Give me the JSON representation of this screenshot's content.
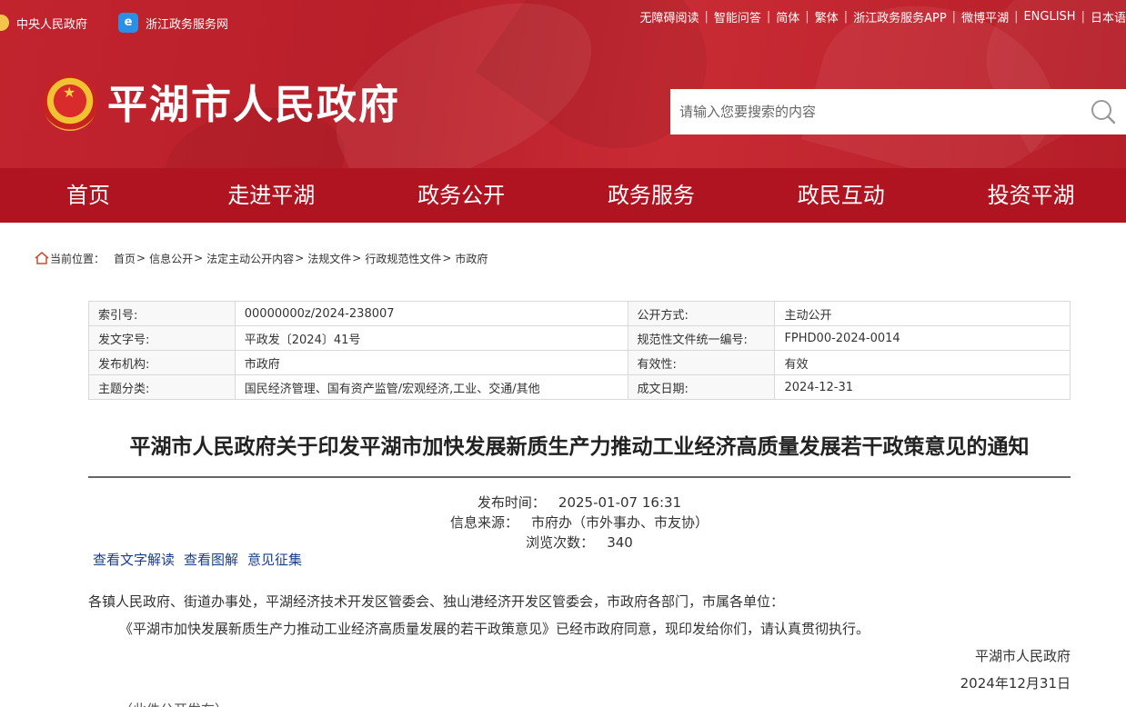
{
  "header": {
    "top_left_links": [
      {
        "label": "中央人民政府",
        "icon": "emblem-icon"
      },
      {
        "label": "浙江政务服务网",
        "icon": "zjzwfw-logo-icon"
      }
    ],
    "top_right_links": [
      "无障碍阅读",
      "智能问答",
      "简体",
      "繁体",
      "浙江政务服务APP",
      "微博平湖",
      "ENGLISH",
      "日本语"
    ],
    "site_title": "平湖市人民政府",
    "search_placeholder": "请输入您要搜索的内容"
  },
  "nav": {
    "items": [
      "首页",
      "走进平湖",
      "政务公开",
      "政务服务",
      "政民互动",
      "投资平湖"
    ]
  },
  "breadcrumb": {
    "label": "当前位置：",
    "items": [
      "首页",
      "信息公开",
      "法定主动公开内容",
      "法规文件",
      "行政规范性文件",
      "市政府"
    ]
  },
  "meta": {
    "rows": [
      {
        "l1": "索引号:",
        "v1": "00000000z/2024-238007",
        "l2": "公开方式:",
        "v2": "主动公开"
      },
      {
        "l1": "发文字号:",
        "v1": "平政发〔2024〕41号",
        "l2": "规范性文件统一编号:",
        "v2": "FPHD00-2024-0014"
      },
      {
        "l1": "发布机构:",
        "v1": "市政府",
        "l2": "有效性:",
        "v2": "有效"
      },
      {
        "l1": "主题分类:",
        "v1": "国民经济管理、国有资产监管/宏观经济,工业、交通/其他",
        "l2": "成文日期:",
        "v2": "2024-12-31"
      }
    ]
  },
  "article": {
    "title": "平湖市人民政府关于印发平湖市加快发展新质生产力推动工业经济高质量发展若干政策意见的通知",
    "publish_label": "发布时间：",
    "publish_value": "2025-01-07 16:31",
    "source_label": "信息来源：",
    "source_value": "市府办（市外事办、市友协）",
    "views_label": "浏览次数：",
    "views_value": "340",
    "links": [
      "查看文字解读",
      "查看图解",
      "意见征集"
    ],
    "para1": "各镇人民政府、街道办事处，平湖经济技术开发区管委会、独山港经济开发区管委会，市政府各部门，市属各单位：",
    "para2": "《平湖市加快发展新质生产力推动工业经济高质量发展的若干政策意见》已经市政府同意，现印发给你们，请认真贯彻执行。",
    "signature_org": "平湖市人民政府",
    "signature_date": "2024年12月31日",
    "para3": "（此件公开发布）"
  },
  "colors": {
    "header_red": "#c2242e",
    "nav_red": "#b01421",
    "link_blue": "#1a3e8c"
  }
}
